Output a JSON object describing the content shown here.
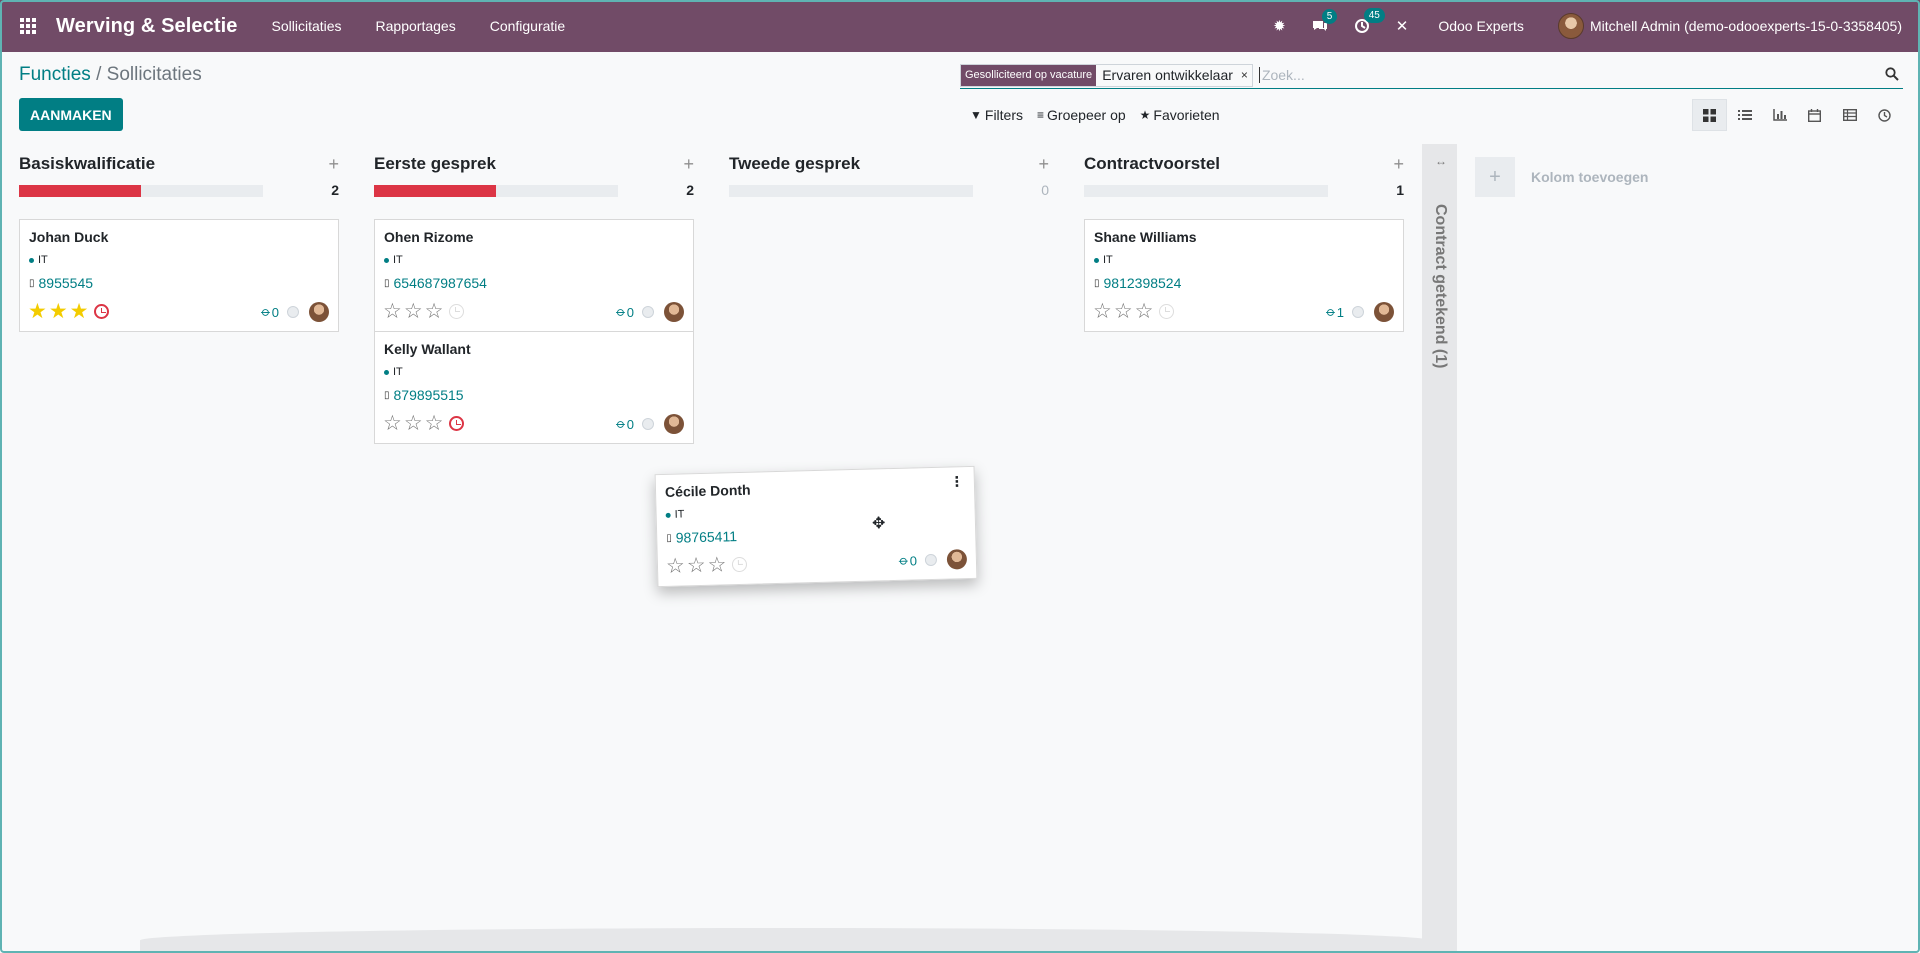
{
  "navbar": {
    "app_name": "Werving & Selectie",
    "menu": [
      "Sollicitaties",
      "Rapportages",
      "Configuratie"
    ],
    "messages_badge": "5",
    "activities_badge": "45",
    "company": "Odoo Experts",
    "user": "Mitchell Admin (demo-odooexperts-15-0-3358405)"
  },
  "breadcrumb": {
    "parent": "Functies",
    "separator": "/",
    "current": "Sollicitaties"
  },
  "create_button": "AANMAKEN",
  "search": {
    "facet_label": "Gesolliciteerd op vacature",
    "facet_value": "Ervaren ontwikkelaar",
    "facet_remove": "×",
    "placeholder": "Zoek..."
  },
  "search_options": {
    "filters": "Filters",
    "group_by": "Groepeer op",
    "favorites": "Favorieten"
  },
  "views": [
    "kanban-view",
    "list-view",
    "graph-view",
    "calendar-view",
    "pivot-view",
    "activity-view"
  ],
  "colors": {
    "primary": "#714b67",
    "accent": "#017e84",
    "danger": "#dc3545",
    "star": "#f3cc00"
  },
  "columns": [
    {
      "title": "Basiskwalificatie",
      "count": "2",
      "progress": 0.5,
      "cards": [
        {
          "name": "Johan Duck",
          "tag": "IT",
          "phone": "8955545",
          "stars": 3,
          "clock": "red",
          "attachments": "0"
        }
      ]
    },
    {
      "title": "Eerste gesprek",
      "count": "2",
      "progress": 0.5,
      "cards": [
        {
          "name": "Ohen Rizome",
          "tag": "IT",
          "phone": "654687987654",
          "stars": 0,
          "clock": "grey",
          "attachments": "0"
        },
        {
          "name": "Kelly Wallant",
          "tag": "IT",
          "phone": "879895515",
          "stars": 0,
          "clock": "red",
          "attachments": "0"
        }
      ]
    },
    {
      "title": "Tweede gesprek",
      "count": "0",
      "progress": 0,
      "cards": []
    },
    {
      "title": "Contractvoorstel",
      "count": "1",
      "progress": 0,
      "cards": [
        {
          "name": "Shane Williams",
          "tag": "IT",
          "phone": "9812398524",
          "stars": 0,
          "clock": "grey",
          "attachments": "1"
        }
      ]
    }
  ],
  "dragging_card": {
    "name": "Cécile Donth",
    "tag": "IT",
    "phone": "98765411",
    "stars": 0,
    "clock": "grey",
    "attachments": "0"
  },
  "folded_column": {
    "title": "Contract getekend (1)"
  },
  "add_column": {
    "label": "Kolom toevoegen"
  }
}
